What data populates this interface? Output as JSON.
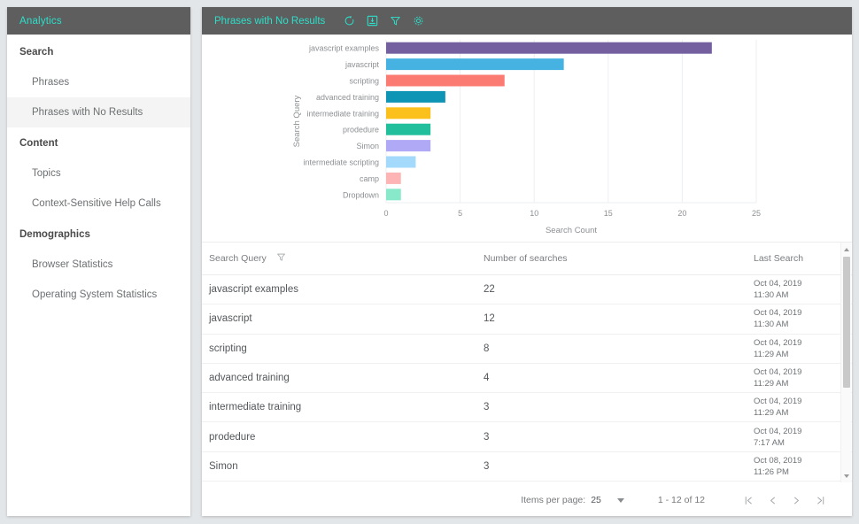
{
  "sidebar": {
    "header_title": "Analytics",
    "groups": [
      {
        "label": "Search",
        "items": [
          {
            "label": "Phrases",
            "active": false
          },
          {
            "label": "Phrases with No Results",
            "active": true
          }
        ]
      },
      {
        "label": "Content",
        "items": [
          {
            "label": "Topics",
            "active": false
          },
          {
            "label": "Context-Sensitive Help Calls",
            "active": false
          }
        ]
      },
      {
        "label": "Demographics",
        "items": [
          {
            "label": "Browser Statistics",
            "active": false
          },
          {
            "label": "Operating System Statistics",
            "active": false
          }
        ]
      }
    ]
  },
  "main": {
    "header_title": "Phrases with No Results",
    "header_icons": [
      {
        "name": "refresh-icon",
        "title": "Refresh"
      },
      {
        "name": "export-icon",
        "title": "Export"
      },
      {
        "name": "filter-icon",
        "title": "Filter"
      },
      {
        "name": "gear-icon",
        "title": "Settings"
      }
    ],
    "accent_color": "#2ddfc9",
    "header_bg": "#5e5e5e"
  },
  "chart_data": {
    "type": "bar",
    "orientation": "horizontal",
    "title": "",
    "xlabel": "Search Count",
    "ylabel": "Search Query",
    "xlim": [
      0,
      25
    ],
    "xticks": [
      0,
      5,
      10,
      15,
      20,
      25
    ],
    "grid": "vertical",
    "legend": "none",
    "categories": [
      "javascript examples",
      "javascript",
      "scripting",
      "advanced training",
      "intermediate training",
      "prodedure",
      "Simon",
      "intermediate scripting",
      "camp",
      "Dropdown"
    ],
    "values": [
      22,
      12,
      8,
      4,
      3,
      3,
      3,
      2,
      1,
      1
    ],
    "colors": [
      "#75609f",
      "#45b2e1",
      "#fb7b72",
      "#0e94b5",
      "#fcc01c",
      "#21bf9b",
      "#b0a9f6",
      "#a3dafb",
      "#fcb4b4",
      "#87e8ca"
    ]
  },
  "table": {
    "columns": [
      {
        "key": "query",
        "label": "Search Query",
        "has_filter": true
      },
      {
        "key": "count",
        "label": "Number of searches",
        "has_filter": false
      },
      {
        "key": "last",
        "label": "Last Search",
        "has_filter": false
      }
    ],
    "rows": [
      {
        "query": "javascript examples",
        "count": "22",
        "date": "Oct 04, 2019",
        "time": "11:30 AM"
      },
      {
        "query": "javascript",
        "count": "12",
        "date": "Oct 04, 2019",
        "time": "11:30 AM"
      },
      {
        "query": "scripting",
        "count": "8",
        "date": "Oct 04, 2019",
        "time": "11:29 AM"
      },
      {
        "query": "advanced training",
        "count": "4",
        "date": "Oct 04, 2019",
        "time": "11:29 AM"
      },
      {
        "query": "intermediate training",
        "count": "3",
        "date": "Oct 04, 2019",
        "time": "11:29 AM"
      },
      {
        "query": "prodedure",
        "count": "3",
        "date": "Oct 04, 2019",
        "time": "7:17 AM"
      },
      {
        "query": "Simon",
        "count": "3",
        "date": "Oct 08, 2019",
        "time": "11:26 PM"
      }
    ]
  },
  "paginator": {
    "items_per_page_label": "Items per page:",
    "items_per_page_value": "25",
    "range_label": "1 - 12 of 12",
    "buttons": [
      {
        "name": "first-page-button",
        "glyph": "first"
      },
      {
        "name": "previous-page-button",
        "glyph": "prev"
      },
      {
        "name": "next-page-button",
        "glyph": "next"
      },
      {
        "name": "last-page-button",
        "glyph": "last"
      }
    ]
  }
}
